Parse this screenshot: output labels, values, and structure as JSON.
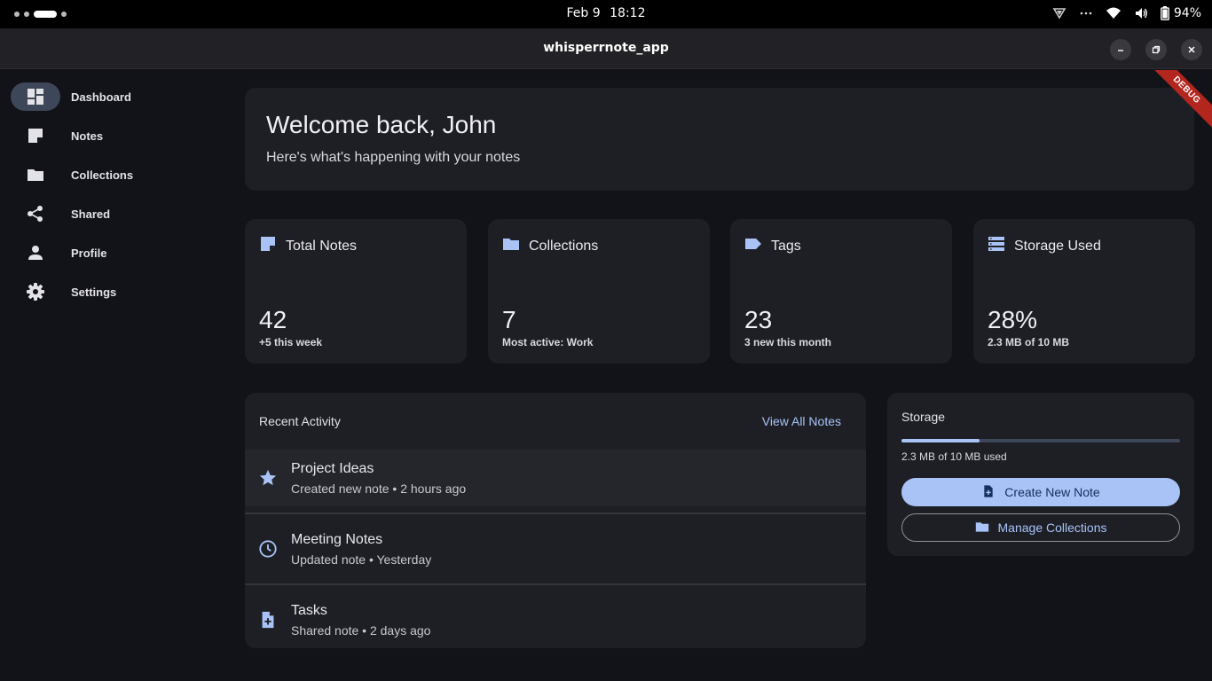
{
  "system_bar": {
    "date": "Feb 9",
    "time": "18:12",
    "battery": "94%"
  },
  "window": {
    "title": "whisperrnote_app",
    "debug_label": "DEBUG"
  },
  "sidebar": {
    "items": [
      {
        "label": "Dashboard",
        "icon": "dashboard-icon",
        "active": true
      },
      {
        "label": "Notes",
        "icon": "note-icon"
      },
      {
        "label": "Collections",
        "icon": "folder-icon"
      },
      {
        "label": "Shared",
        "icon": "share-icon"
      },
      {
        "label": "Profile",
        "icon": "person-icon"
      },
      {
        "label": "Settings",
        "icon": "gear-icon"
      }
    ]
  },
  "welcome": {
    "title": "Welcome back, John",
    "subtitle": "Here's what's happening with your notes"
  },
  "stats": [
    {
      "label": "Total Notes",
      "icon": "note-icon",
      "value": "42",
      "sub": "+5 this week"
    },
    {
      "label": "Collections",
      "icon": "folder-icon",
      "value": "7",
      "sub": "Most active: Work"
    },
    {
      "label": "Tags",
      "icon": "tag-icon",
      "value": "23",
      "sub": "3 new this month"
    },
    {
      "label": "Storage Used",
      "icon": "storage-icon",
      "value": "28%",
      "sub": "2.3 MB of 10 MB"
    }
  ],
  "activity": {
    "header": "Recent Activity",
    "view_all": "View All Notes",
    "items": [
      {
        "title": "Project Ideas",
        "detail": "Created new note • 2 hours ago",
        "icon": "star-icon"
      },
      {
        "title": "Meeting Notes",
        "detail": "Updated note • Yesterday",
        "icon": "clock-icon"
      },
      {
        "title": "Tasks",
        "detail": "Shared note • 2 days ago",
        "icon": "note-add-icon"
      }
    ]
  },
  "storage": {
    "header": "Storage",
    "used_fraction": 0.28,
    "used_text": "2.3 MB of 10 MB used",
    "create_button": "Create New Note",
    "manage_button": "Manage Collections"
  },
  "colors": {
    "accent": "#a9c3f7",
    "background": "#111318",
    "card": "#1d1f25",
    "debug": "#b3261e"
  }
}
